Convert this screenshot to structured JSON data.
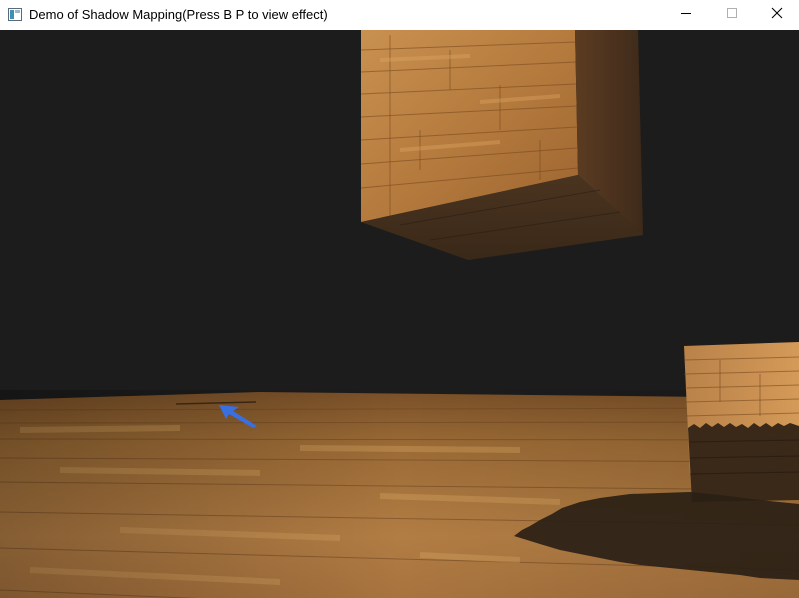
{
  "window": {
    "title": "Demo of Shadow Mapping(Press B P to view effect)",
    "icon": "app-window-icon",
    "controls": {
      "minimize": "minimize-icon",
      "maximize": "maximize-icon",
      "close": "close-icon"
    }
  },
  "scene": {
    "background_color": "#1c1c1c",
    "floor_color": "#b07a3e",
    "wood_light": "#c98c48",
    "wood_dark": "#7a4a20",
    "shadow_color": "#2a1f15",
    "cursor_color": "#3a6fe0"
  }
}
